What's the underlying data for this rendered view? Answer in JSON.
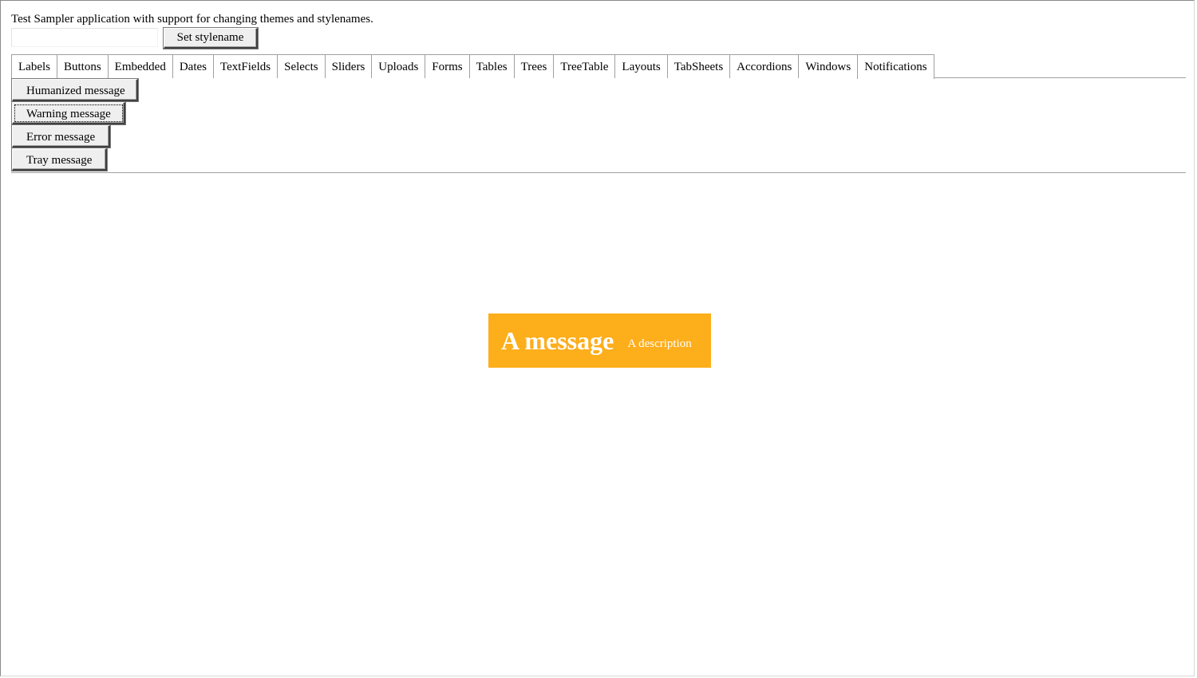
{
  "app": {
    "description": "Test Sampler application with support for changing themes and stylenames.",
    "stylename_input": {
      "value": "",
      "placeholder": ""
    },
    "set_stylename_label": "Set stylename"
  },
  "tabs": [
    {
      "label": "Labels"
    },
    {
      "label": "Buttons"
    },
    {
      "label": "Embedded"
    },
    {
      "label": "Dates"
    },
    {
      "label": "TextFields"
    },
    {
      "label": "Selects"
    },
    {
      "label": "Sliders"
    },
    {
      "label": "Uploads"
    },
    {
      "label": "Forms"
    },
    {
      "label": "Tables"
    },
    {
      "label": "Trees"
    },
    {
      "label": "TreeTable"
    },
    {
      "label": "Layouts"
    },
    {
      "label": "TabSheets"
    },
    {
      "label": "Accordions"
    },
    {
      "label": "Windows"
    },
    {
      "label": "Notifications"
    }
  ],
  "selected_tab": "Notifications",
  "notifications_panel": {
    "buttons": [
      {
        "label": "Humanized message"
      },
      {
        "label": "Warning message"
      },
      {
        "label": "Error message"
      },
      {
        "label": "Tray message"
      }
    ]
  },
  "notification": {
    "caption": "A message",
    "description": "A description",
    "background_color": "#fdae1b",
    "text_color": "#ffffff"
  }
}
